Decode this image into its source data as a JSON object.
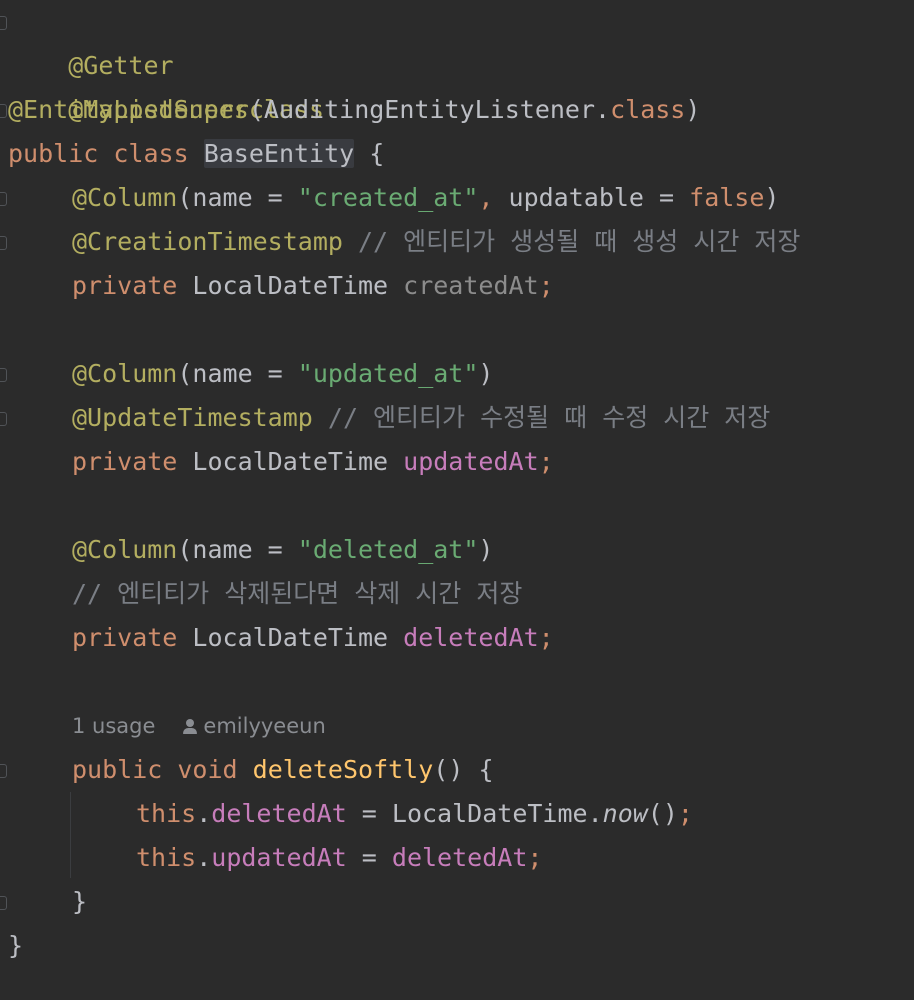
{
  "editor": {
    "line1": {
      "annotation": "@Getter"
    },
    "line2": {
      "annotation": "@MappedSuperclass"
    },
    "line3": {
      "annotation": "@EntityListeners",
      "open": "(",
      "cls": "AuditingEntityListener",
      "dot": ".",
      "kw": "class",
      "close": ")"
    },
    "line4": {
      "kw1": "public",
      "kw2": "class",
      "cls": "BaseEntity",
      "brace": "{"
    },
    "line5": {
      "annotation": "@Column",
      "open": "(name = ",
      "str1": "\"created_at\"",
      "comma": ", ",
      "param": "updatable = ",
      "kw": "false",
      "close": ")"
    },
    "line6": {
      "annotation": "@CreationTimestamp",
      "comment": "// 엔티티가 생성될 때 생성 시간 저장"
    },
    "line7": {
      "kw": "private",
      "type": "LocalDateTime",
      "field": "createdAt",
      "semi": ";"
    },
    "line9": {
      "annotation": "@Column",
      "open": "(name = ",
      "str1": "\"updated_at\"",
      "close": ")"
    },
    "line10": {
      "annotation": "@UpdateTimestamp",
      "comment": "// 엔티티가 수정될 때 수정 시간 저장"
    },
    "line11": {
      "kw": "private",
      "type": "LocalDateTime",
      "field": "updatedAt",
      "semi": ";"
    },
    "line13": {
      "annotation": "@Column",
      "open": "(name = ",
      "str1": "\"deleted_at\"",
      "close": ")"
    },
    "line14": {
      "comment": "// 엔티티가 삭제된다면 삭제 시간 저장"
    },
    "line15": {
      "kw": "private",
      "type": "LocalDateTime",
      "field": "deletedAt",
      "semi": ";"
    },
    "hint": {
      "usages": "1 usage",
      "author": "emilyyeeun"
    },
    "line17": {
      "kw1": "public",
      "kw2": "void",
      "method": "deleteSoftly",
      "parens": "() ",
      "brace": "{"
    },
    "line18": {
      "kw": "this",
      "dot": ".",
      "field": "deletedAt",
      "assign": " = ",
      "cls": "LocalDateTime",
      "dot2": ".",
      "method": "now",
      "call": "()",
      "semi": ";"
    },
    "line19": {
      "kw": "this",
      "dot": ".",
      "field": "updatedAt",
      "assign": " = ",
      "field2": "deletedAt",
      "semi": ";"
    },
    "line20": {
      "brace": "}"
    },
    "line21": {
      "brace": "}"
    }
  },
  "colors": {
    "background": "#2b2b2b",
    "keyword": "#cf8e6d",
    "annotation": "#b3ae60",
    "string": "#6aab73",
    "comment": "#7a7e85",
    "field": "#c77dbb",
    "method_decl": "#ffc66d"
  },
  "icons": {
    "author": "user-icon"
  }
}
